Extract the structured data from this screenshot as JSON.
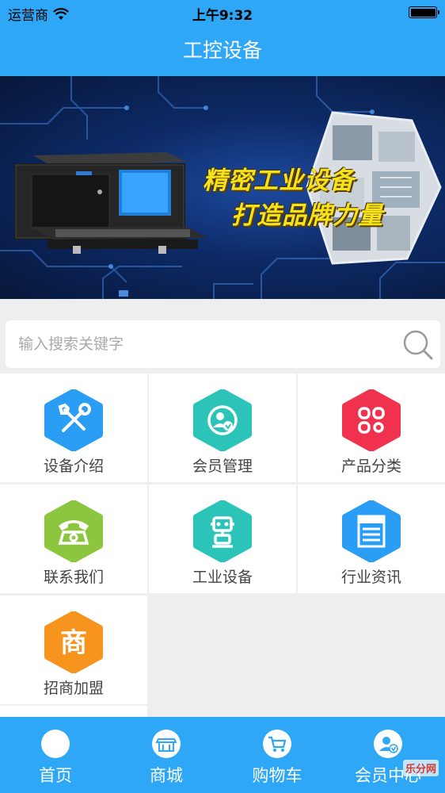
{
  "status_bar": {
    "carrier": "运营商",
    "time": "上午9:32"
  },
  "nav": {
    "title": "工控设备"
  },
  "banner": {
    "line1": "精密工业设备",
    "line2": "打造品牌力量"
  },
  "search": {
    "placeholder": "输入搜索关键字",
    "value": ""
  },
  "grid": {
    "items": [
      {
        "label": "设备介绍",
        "icon": "tools-icon",
        "color": "#2a9df4"
      },
      {
        "label": "会员管理",
        "icon": "member-icon",
        "color": "#2cc4b8"
      },
      {
        "label": "产品分类",
        "icon": "category-icon",
        "color": "#f0324f"
      },
      {
        "label": "联系我们",
        "icon": "telephone-icon",
        "color": "#8cc63f"
      },
      {
        "label": "工业设备",
        "icon": "robot-icon",
        "color": "#2cc4b8"
      },
      {
        "label": "行业资讯",
        "icon": "news-icon",
        "color": "#2a9df4"
      },
      {
        "label": "招商加盟",
        "icon": "shop-icon",
        "color": "#f7941d",
        "glyph": "商"
      }
    ]
  },
  "tabs": [
    {
      "label": "首页",
      "icon": "home-icon"
    },
    {
      "label": "商城",
      "icon": "store-icon"
    },
    {
      "label": "购物车",
      "icon": "cart-icon"
    },
    {
      "label": "会员中心",
      "icon": "member-center-icon"
    }
  ],
  "watermark": {
    "text": "乐分网"
  },
  "colors": {
    "primary": "#2ea7f7",
    "slogan": "#f6e21a"
  }
}
